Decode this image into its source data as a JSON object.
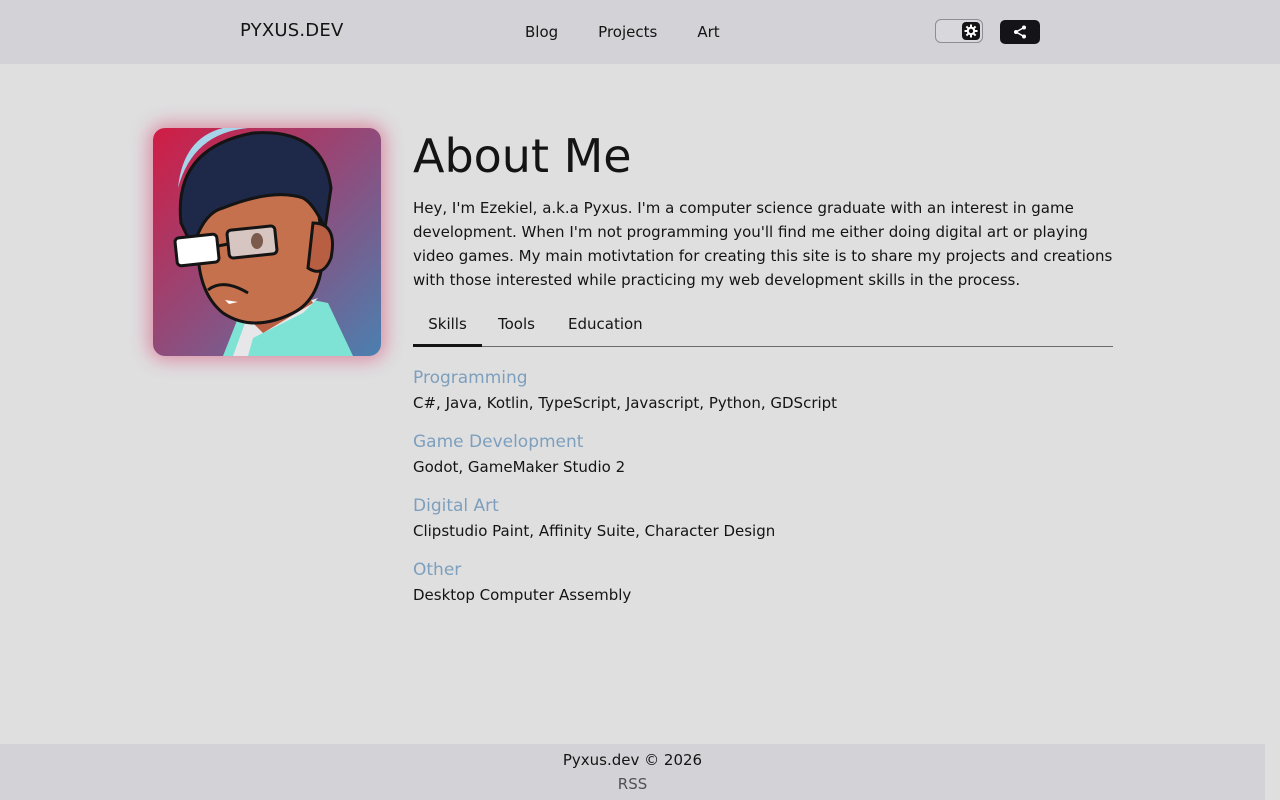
{
  "header": {
    "brand": "PYXUS.DEV",
    "nav": [
      {
        "label": "Blog"
      },
      {
        "label": "Projects"
      },
      {
        "label": "Art"
      }
    ]
  },
  "icons": {
    "theme_toggle": "gear-icon",
    "share": "share-icon"
  },
  "profile": {
    "title": "About Me",
    "intro": "Hey, I'm Ezekiel, a.k.a Pyxus. I'm a computer science graduate with an interest in game development. When I'm not programming you'll find me either doing digital art or playing video games. My main motivtation for creating this site is to share my projects and creations with those interested while practicing my web development skills in the process."
  },
  "tabs": [
    {
      "label": "Skills",
      "active": true
    },
    {
      "label": "Tools",
      "active": false
    },
    {
      "label": "Education",
      "active": false
    }
  ],
  "skills": [
    {
      "title": "Programming",
      "value": "C#, Java, Kotlin, TypeScript, Javascript, Python, GDScript"
    },
    {
      "title": "Game Development",
      "value": "Godot, GameMaker Studio 2"
    },
    {
      "title": "Digital Art",
      "value": "Clipstudio Paint, Affinity Suite, Character Design"
    },
    {
      "title": "Other",
      "value": "Desktop Computer Assembly"
    }
  ],
  "footer": {
    "copyright": "Pyxus.dev © 2026",
    "rss": "RSS"
  },
  "colors": {
    "accent": "#7d9fbd",
    "header_bg": "#d3d3d7",
    "page_bg": "#dfdfe0",
    "text": "#141414"
  }
}
